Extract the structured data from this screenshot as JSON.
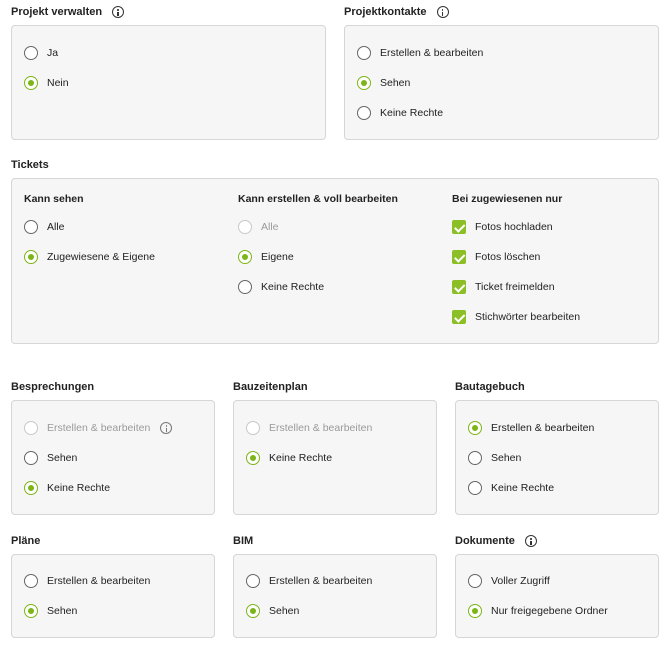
{
  "projekt_verwalten": {
    "title": "Projekt verwalten",
    "options": [
      "Ja",
      "Nein"
    ]
  },
  "projektkontakte": {
    "title": "Projektkontakte",
    "options": [
      "Erstellen & bearbeiten",
      "Sehen",
      "Keine Rechte"
    ]
  },
  "tickets": {
    "title": "Tickets",
    "kann_sehen": {
      "heading": "Kann sehen",
      "options": [
        "Alle",
        "Zugewiesene & Eigene"
      ]
    },
    "kann_erstellen": {
      "heading": "Kann erstellen & voll bearbeiten",
      "options": [
        "Alle",
        "Eigene",
        "Keine Rechte"
      ]
    },
    "bei_zugewiesenen": {
      "heading": "Bei zugewiesenen nur",
      "options": [
        "Fotos hochladen",
        "Fotos löschen",
        "Ticket freimelden",
        "Stichwörter bearbeiten"
      ]
    }
  },
  "besprechungen": {
    "title": "Besprechungen",
    "options": [
      "Erstellen & bearbeiten",
      "Sehen",
      "Keine Rechte"
    ]
  },
  "bauzeitenplan": {
    "title": "Bauzeitenplan",
    "options": [
      "Erstellen & bearbeiten",
      "Keine Rechte"
    ]
  },
  "bautagebuch": {
    "title": "Bautagebuch",
    "options": [
      "Erstellen & bearbeiten",
      "Sehen",
      "Keine Rechte"
    ]
  },
  "plaene": {
    "title": "Pläne",
    "options": [
      "Erstellen & bearbeiten",
      "Sehen"
    ]
  },
  "bim": {
    "title": "BIM",
    "options": [
      "Erstellen & bearbeiten",
      "Sehen"
    ]
  },
  "dokumente": {
    "title": "Dokumente",
    "options": [
      "Voller Zugriff",
      "Nur freigegebene Ordner"
    ]
  },
  "colors": {
    "accent": "#7cb518",
    "checkbox": "#8cbf26",
    "panel_bg": "#f6f6f6",
    "panel_border": "#d6d6d6"
  }
}
